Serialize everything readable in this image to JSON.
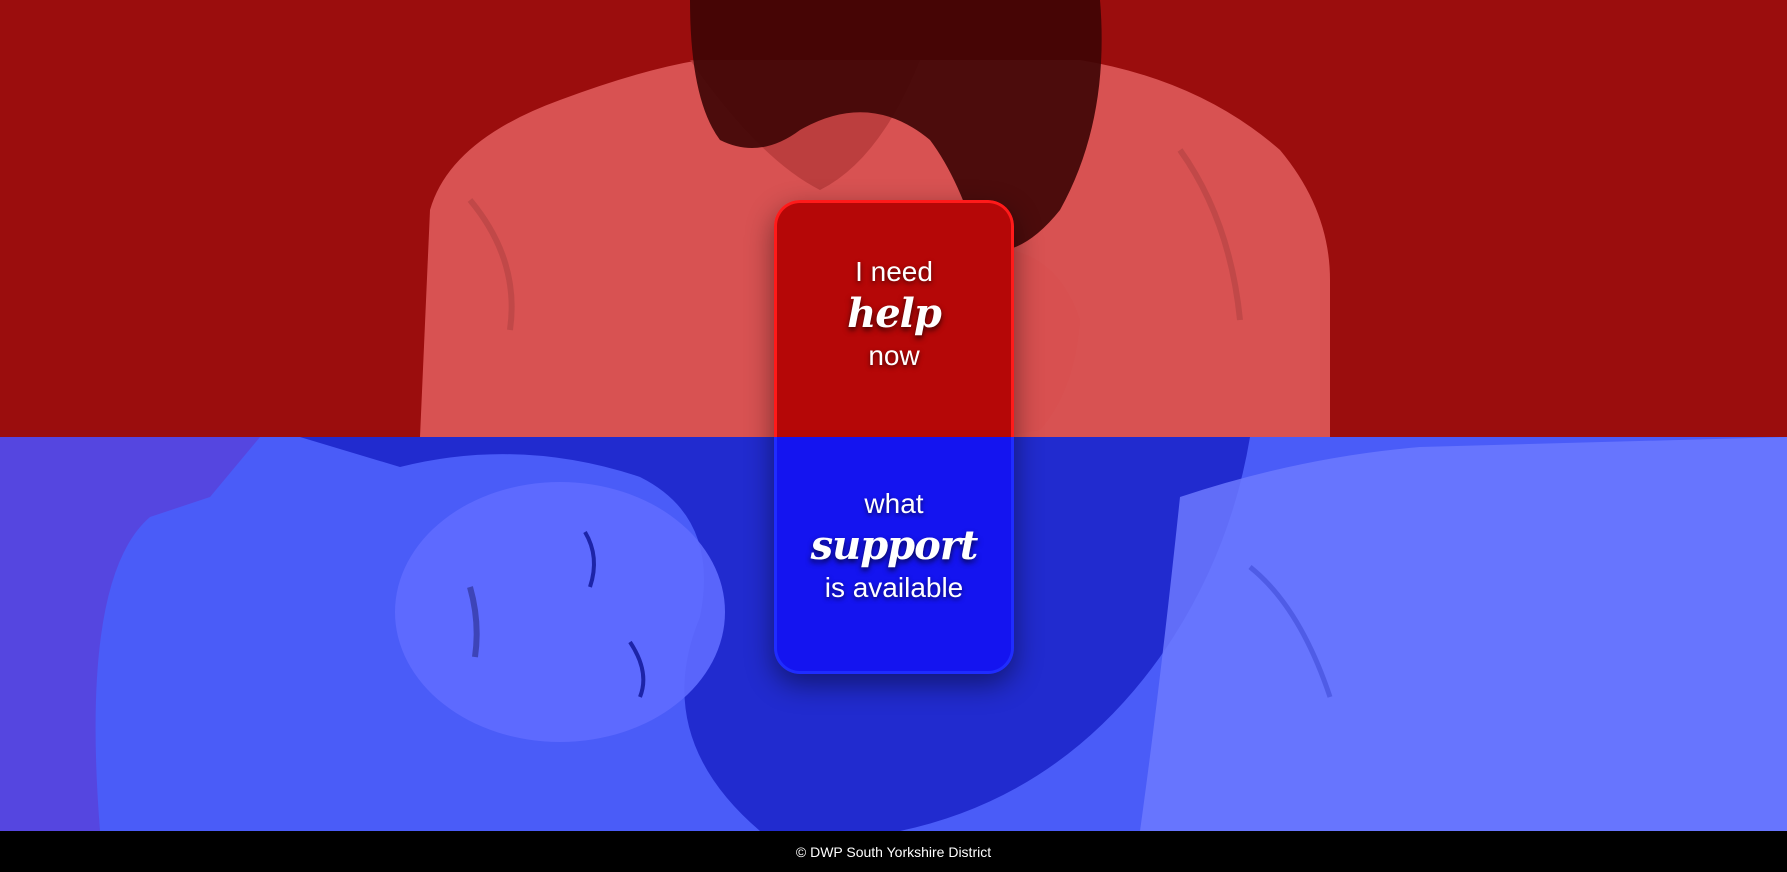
{
  "hero": {
    "top_panel": {
      "image": "man-holding-head-photo",
      "overlay_color": "#9b0d0d"
    },
    "bottom_panel": {
      "image": "woman-lying-down-photo",
      "overlay_color": "#4a5cf8"
    }
  },
  "card": {
    "help": {
      "line1": "I need",
      "emphasis": "help",
      "line3": "now",
      "color": "#b50707",
      "border_color": "#ff1a1a"
    },
    "support": {
      "line1": "what",
      "emphasis": "support",
      "line3": "is available",
      "color": "#1414f0",
      "border_color": "#1f2cff"
    }
  },
  "footer": {
    "copyright": "© DWP South Yorkshire District"
  }
}
